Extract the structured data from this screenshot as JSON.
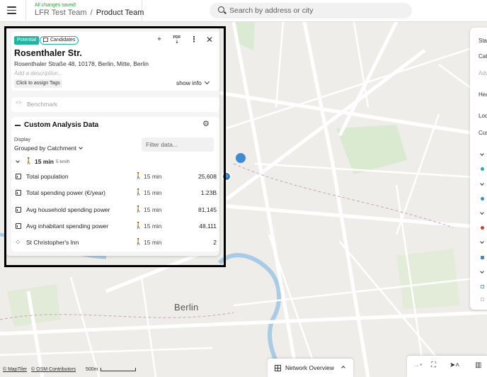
{
  "header": {
    "save_status": "All changes saved!",
    "team": "LFR Test Team",
    "separator": "/",
    "project": "Product Team"
  },
  "search": {
    "placeholder": "Search by address or city",
    "value": ""
  },
  "location": {
    "status_badge": "Potential",
    "candidates_badge": "Candidates",
    "actions": {
      "pin_icon": "location-pin-icon",
      "pdf_label": "PDF",
      "more_icon": "more-vert-icon",
      "close_icon": "close-icon"
    },
    "title": "Rosenthaler Str.",
    "address": "Rosenthaler Straße 48, 10178, Berlin, Mitte, Berlin",
    "description_placeholder": "Add a description...",
    "tags_label": "Click to assign Tags",
    "show_info_label": "show info"
  },
  "benchmark": {
    "icon": "<>",
    "label": "Benchmark"
  },
  "custom_analysis": {
    "title": "Custom Analysis Data",
    "display_label": "Display",
    "display_value": "Grouped by Catchment",
    "filter_placeholder": "Filter data...",
    "group": {
      "time": "15 min",
      "speed": "5 km/h"
    },
    "rows": [
      {
        "name": "Total population",
        "time": "15 min",
        "value": "25,608",
        "icon": "chart-icon"
      },
      {
        "name": "Total spending power (€/year)",
        "time": "15 min",
        "value": "1.23B",
        "icon": "chart-icon"
      },
      {
        "name": "Avg household spending power",
        "time": "15 min",
        "value": "81,145",
        "icon": "chart-icon"
      },
      {
        "name": "Avg inhabitant spending power",
        "time": "15 min",
        "value": "48,111",
        "icon": "chart-icon"
      },
      {
        "name": "St Christopher's Inn",
        "time": "15 min",
        "value": "2",
        "icon": "scatter-icon"
      }
    ]
  },
  "right_panel": {
    "items": [
      "Sta",
      "Cat",
      "Adv",
      "Hea",
      "Loc",
      "Cus"
    ]
  },
  "map": {
    "city_label": "Berlin",
    "attribution_maptiler": "© MapTiler",
    "attribution_osm": "© OSM Contributors",
    "scale_label": "500m"
  },
  "bottom": {
    "network_overview_label": "Network Overview"
  },
  "colors": {
    "accent_teal": "#1fb5a0",
    "saved_green": "#2a9d3a",
    "marker_blue": "#3d8bd4"
  }
}
